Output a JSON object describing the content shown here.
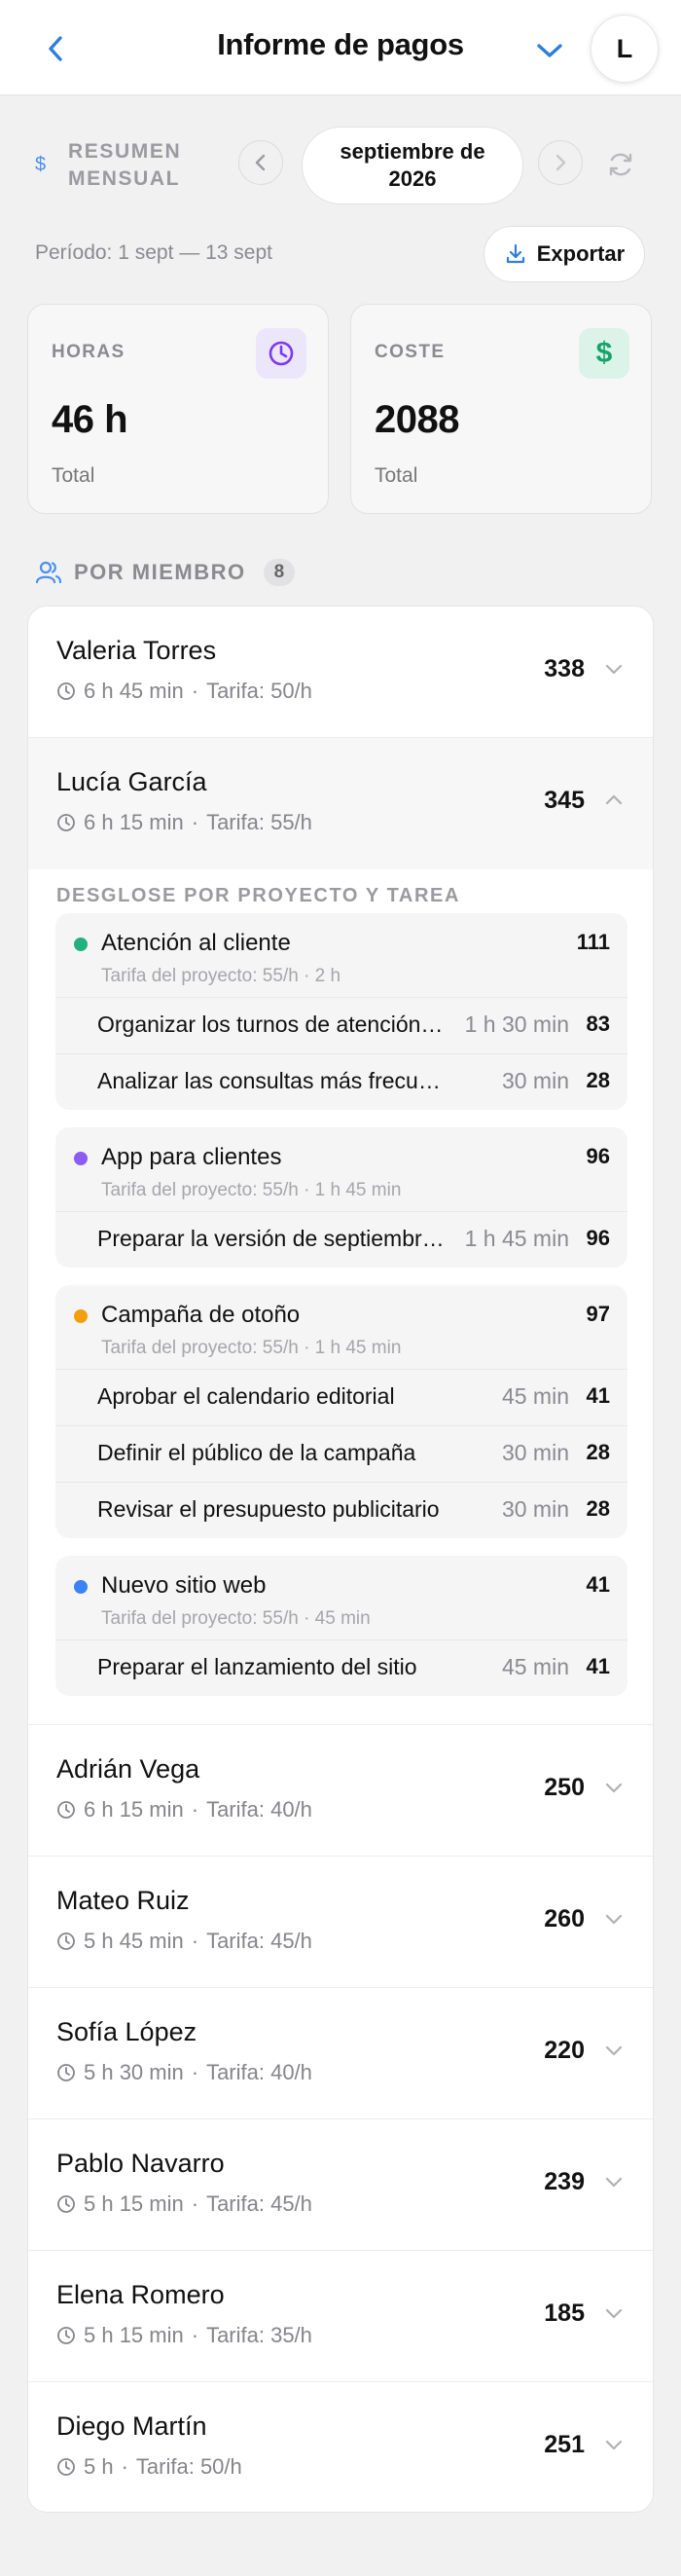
{
  "header": {
    "title": "Informe de pagos",
    "avatar_letter": "L"
  },
  "summary": {
    "label": "RESUMEN MENSUAL",
    "month": "septiembre de 2026",
    "period": "Período: 1 sept — 13 sept",
    "export_label": "Exportar"
  },
  "stats": {
    "hours": {
      "label": "HORAS",
      "value": "46 h",
      "sub": "Total"
    },
    "cost": {
      "label": "COSTE",
      "value": "2088",
      "sub": "Total"
    }
  },
  "members_section": {
    "label": "POR MIEMBRO",
    "count": "8"
  },
  "members": [
    {
      "name": "Valeria Torres",
      "time": "6 h 45 min",
      "rate": "Tarifa: 50/h",
      "amount": "338",
      "expanded": false
    },
    {
      "name": "Lucía García",
      "time": "6 h 15 min",
      "rate": "Tarifa: 55/h",
      "amount": "345",
      "expanded": true
    },
    {
      "name": "Adrián Vega",
      "time": "6 h 15 min",
      "rate": "Tarifa: 40/h",
      "amount": "250",
      "expanded": false
    },
    {
      "name": "Mateo Ruiz",
      "time": "5 h 45 min",
      "rate": "Tarifa: 45/h",
      "amount": "260",
      "expanded": false
    },
    {
      "name": "Sofía López",
      "time": "5 h 30 min",
      "rate": "Tarifa: 40/h",
      "amount": "220",
      "expanded": false
    },
    {
      "name": "Pablo Navarro",
      "time": "5 h 15 min",
      "rate": "Tarifa: 45/h",
      "amount": "239",
      "expanded": false
    },
    {
      "name": "Elena Romero",
      "time": "5 h 15 min",
      "rate": "Tarifa: 35/h",
      "amount": "185",
      "expanded": false
    },
    {
      "name": "Diego Martín",
      "time": "5 h",
      "rate": "Tarifa: 50/h",
      "amount": "251",
      "expanded": false
    }
  ],
  "breakdown": {
    "title": "DESGLOSE POR PROYECTO Y TAREA",
    "projects": [
      {
        "name": "Atención al cliente",
        "color": "#22b07d",
        "amount": "111",
        "rate": "Tarifa del proyecto: 55/h",
        "time": "2 h",
        "tasks": [
          {
            "name": "Organizar los turnos de atención al cliente",
            "duration": "1 h 30 min",
            "amount": "83"
          },
          {
            "name": "Analizar las consultas más frecuentes",
            "duration": "30 min",
            "amount": "28"
          }
        ]
      },
      {
        "name": "App para clientes",
        "color": "#8b5cf6",
        "amount": "96",
        "rate": "Tarifa del proyecto: 55/h",
        "time": "1 h 45 min",
        "tasks": [
          {
            "name": "Preparar la versión de septiembre de la app",
            "duration": "1 h 45 min",
            "amount": "96"
          }
        ]
      },
      {
        "name": "Campaña de otoño",
        "color": "#f59e0b",
        "amount": "97",
        "rate": "Tarifa del proyecto: 55/h",
        "time": "1 h 45 min",
        "tasks": [
          {
            "name": "Aprobar el calendario editorial",
            "duration": "45 min",
            "amount": "41"
          },
          {
            "name": "Definir el público de la campaña",
            "duration": "30 min",
            "amount": "28"
          },
          {
            "name": "Revisar el presupuesto publicitario",
            "duration": "30 min",
            "amount": "28"
          }
        ]
      },
      {
        "name": "Nuevo sitio web",
        "color": "#3b82f6",
        "amount": "41",
        "rate": "Tarifa del proyecto: 55/h",
        "time": "45 min",
        "tasks": [
          {
            "name": "Preparar el lanzamiento del sitio",
            "duration": "45 min",
            "amount": "41"
          }
        ]
      }
    ]
  },
  "colors": {
    "accent": "#2f7fd8",
    "purple_icon": "#7c3aed",
    "green_icon": "#16a36a"
  }
}
